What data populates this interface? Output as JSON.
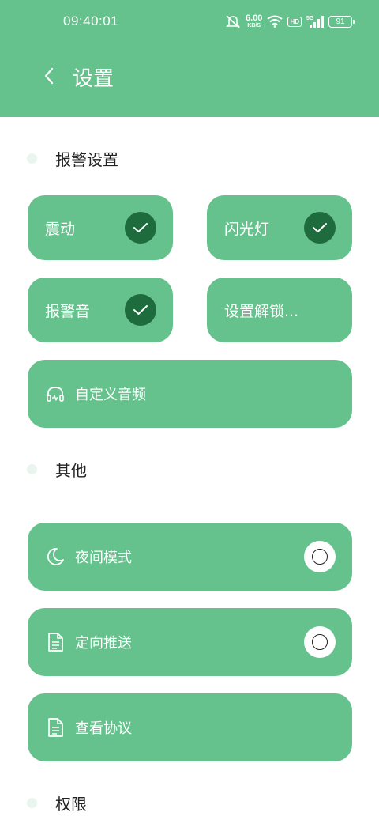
{
  "status_bar": {
    "time": "09:40:01",
    "net_speed_value": "6.00",
    "net_speed_unit": "KB/S",
    "hd_badge": "HD",
    "signal_label": "5G",
    "battery": "91"
  },
  "header": {
    "title": "设置",
    "back_icon": "chevron-left-icon"
  },
  "sections": {
    "alarm": "报警设置",
    "other": "其他",
    "permissions": "权限"
  },
  "alarm_tiles": {
    "vibrate": {
      "label": "震动",
      "checked": true
    },
    "flashlight": {
      "label": "闪光灯",
      "checked": true
    },
    "alarm_sound": {
      "label": "报警音",
      "checked": true
    },
    "unlock_setting": {
      "label": "设置解锁..."
    }
  },
  "custom_audio": {
    "label": "自定义音频",
    "icon": "headphones-icon"
  },
  "other_items": {
    "night_mode": {
      "label": "夜间模式",
      "icon": "moon-icon",
      "checked": false
    },
    "directional_push": {
      "label": "定向推送",
      "icon": "document-icon",
      "checked": false
    },
    "view_agreement": {
      "label": "查看协议",
      "icon": "document-icon"
    }
  },
  "colors": {
    "primary": "#66c28d",
    "check_bg": "#1e6b3d",
    "section_dot": "#e9f5ee"
  }
}
